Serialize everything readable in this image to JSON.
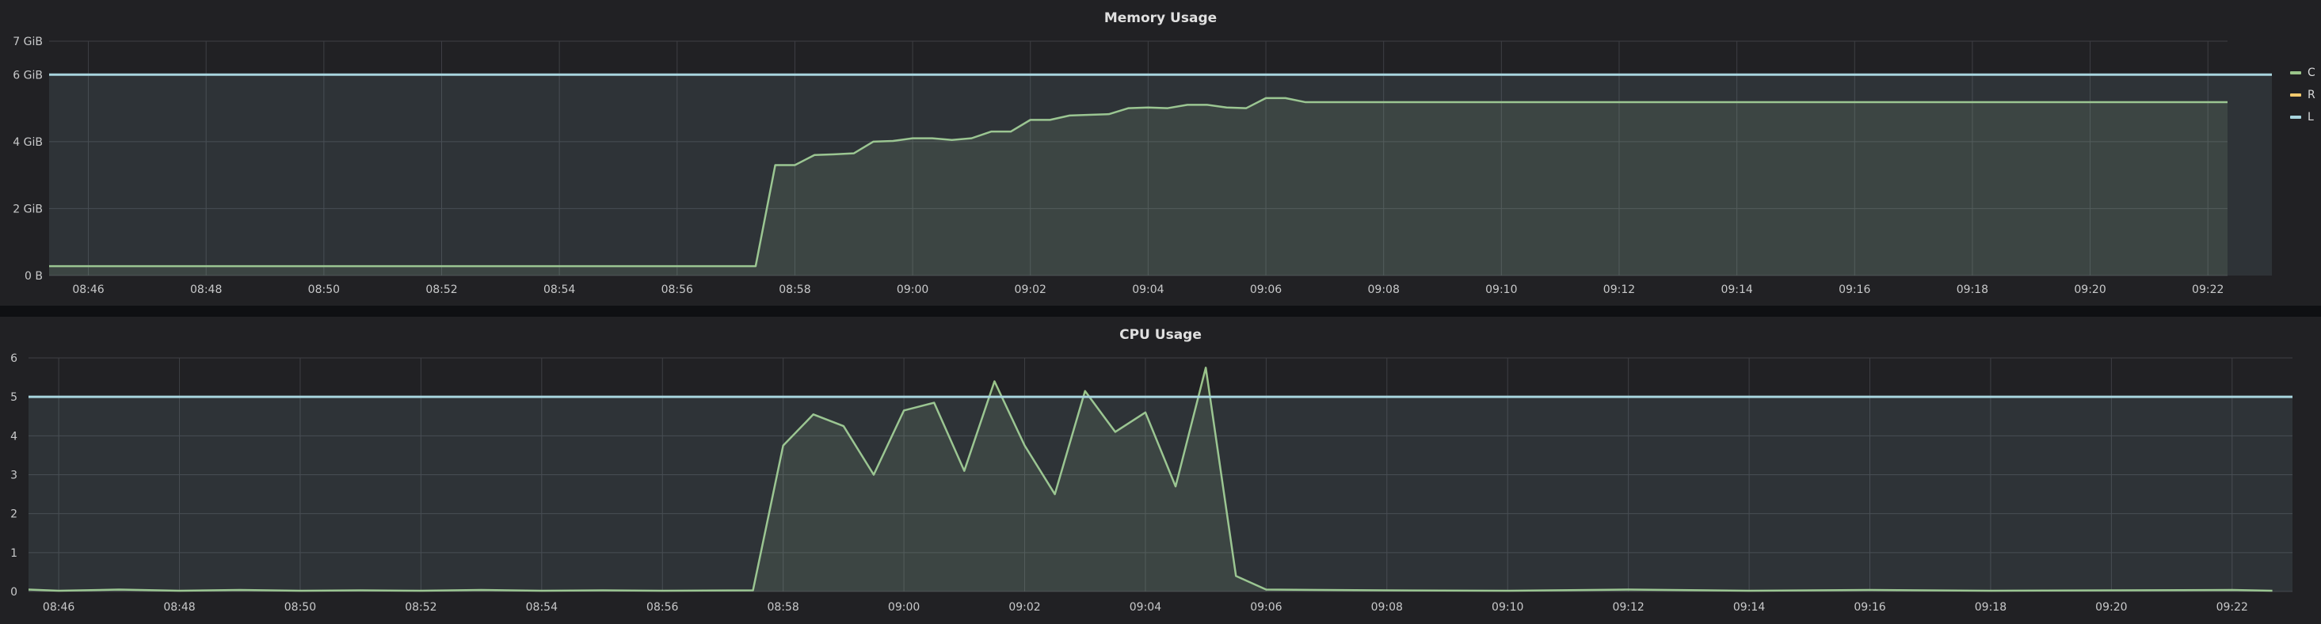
{
  "colors": {
    "series_current": "#9ac48a",
    "series_requests": "#f2c96d",
    "series_limits": "#a8d5de",
    "grid": "#3e3f44",
    "panel_bg": "#212124"
  },
  "legend": {
    "items": [
      {
        "label": "C",
        "color": "#9ac48a"
      },
      {
        "label": "R",
        "color": "#f2c96d"
      },
      {
        "label": "L",
        "color": "#a8d5de"
      }
    ]
  },
  "chart_data": [
    {
      "type": "area",
      "title": "Memory Usage",
      "unit": "GiB",
      "xlim": [
        "08:45:20",
        "09:22:20"
      ],
      "ylim": [
        0,
        7
      ],
      "x_ticks": [
        "08:46",
        "08:48",
        "08:50",
        "08:52",
        "08:54",
        "08:56",
        "08:58",
        "09:00",
        "09:02",
        "09:04",
        "09:06",
        "09:08",
        "09:10",
        "09:12",
        "09:14",
        "09:16",
        "09:18",
        "09:20",
        "09:22"
      ],
      "y_ticks": [
        "0 B",
        "2 GiB",
        "4 GiB",
        "6 GiB",
        "7 GiB"
      ],
      "y_tick_values": [
        0,
        2,
        4,
        6,
        7
      ],
      "grid": true,
      "legend_position": "right",
      "series": [
        {
          "name": "C",
          "color": "#9ac48a",
          "points": [
            [
              "08:45:20",
              0.28
            ],
            [
              "08:57:20",
              0.28
            ],
            [
              "08:57:40",
              3.3
            ],
            [
              "08:58:00",
              3.3
            ],
            [
              "08:58:20",
              3.6
            ],
            [
              "08:58:40",
              3.62
            ],
            [
              "08:59:00",
              3.65
            ],
            [
              "08:59:20",
              4.0
            ],
            [
              "08:59:40",
              4.02
            ],
            [
              "09:00:00",
              4.1
            ],
            [
              "09:00:20",
              4.1
            ],
            [
              "09:00:40",
              4.05
            ],
            [
              "09:01:00",
              4.1
            ],
            [
              "09:01:20",
              4.3
            ],
            [
              "09:01:40",
              4.3
            ],
            [
              "09:02:00",
              4.65
            ],
            [
              "09:02:20",
              4.65
            ],
            [
              "09:02:40",
              4.78
            ],
            [
              "09:03:00",
              4.8
            ],
            [
              "09:03:20",
              4.82
            ],
            [
              "09:03:40",
              5.0
            ],
            [
              "09:04:00",
              5.02
            ],
            [
              "09:04:20",
              5.0
            ],
            [
              "09:04:40",
              5.1
            ],
            [
              "09:05:00",
              5.1
            ],
            [
              "09:05:20",
              5.02
            ],
            [
              "09:05:40",
              5.0
            ],
            [
              "09:06:00",
              5.3
            ],
            [
              "09:06:20",
              5.3
            ],
            [
              "09:06:40",
              5.18
            ],
            [
              "09:22:20",
              5.18
            ]
          ]
        },
        {
          "name": "L",
          "color": "#a8d5de",
          "points": [
            [
              "08:45:20",
              6
            ],
            [
              "09:22:20",
              6
            ]
          ]
        }
      ]
    },
    {
      "type": "area",
      "title": "CPU Usage",
      "unit": "",
      "xlim": [
        "08:45:30",
        "09:23:00"
      ],
      "ylim": [
        0,
        6
      ],
      "x_ticks": [
        "08:46",
        "08:48",
        "08:50",
        "08:52",
        "08:54",
        "08:56",
        "08:58",
        "09:00",
        "09:02",
        "09:04",
        "09:06",
        "09:08",
        "09:10",
        "09:12",
        "09:14",
        "09:16",
        "09:18",
        "09:20",
        "09:22"
      ],
      "y_ticks": [
        "0",
        "1",
        "2",
        "3",
        "4",
        "5",
        "6"
      ],
      "y_tick_values": [
        0,
        1,
        2,
        3,
        4,
        5,
        6
      ],
      "grid": true,
      "legend_position": "right",
      "series": [
        {
          "name": "C",
          "color": "#9ac48a",
          "points": [
            [
              "08:45:30",
              0.05
            ],
            [
              "08:46:00",
              0.02
            ],
            [
              "08:47:00",
              0.05
            ],
            [
              "08:48:00",
              0.02
            ],
            [
              "08:49:00",
              0.04
            ],
            [
              "08:50:00",
              0.02
            ],
            [
              "08:51:00",
              0.03
            ],
            [
              "08:52:00",
              0.02
            ],
            [
              "08:53:00",
              0.04
            ],
            [
              "08:54:00",
              0.02
            ],
            [
              "08:55:00",
              0.03
            ],
            [
              "08:56:00",
              0.02
            ],
            [
              "08:57:30",
              0.03
            ],
            [
              "08:58:00",
              3.75
            ],
            [
              "08:58:30",
              4.55
            ],
            [
              "08:59:00",
              4.25
            ],
            [
              "08:59:30",
              3.0
            ],
            [
              "09:00:00",
              4.65
            ],
            [
              "09:00:30",
              4.85
            ],
            [
              "09:01:00",
              3.1
            ],
            [
              "09:01:30",
              5.4
            ],
            [
              "09:02:00",
              3.75
            ],
            [
              "09:02:30",
              2.5
            ],
            [
              "09:03:00",
              5.15
            ],
            [
              "09:03:30",
              4.1
            ],
            [
              "09:04:00",
              4.6
            ],
            [
              "09:04:30",
              2.7
            ],
            [
              "09:05:00",
              5.75
            ],
            [
              "09:05:30",
              0.4
            ],
            [
              "09:06:00",
              0.05
            ],
            [
              "09:08:00",
              0.03
            ],
            [
              "09:10:00",
              0.02
            ],
            [
              "09:12:00",
              0.05
            ],
            [
              "09:14:00",
              0.02
            ],
            [
              "09:16:00",
              0.04
            ],
            [
              "09:18:00",
              0.02
            ],
            [
              "09:20:00",
              0.03
            ],
            [
              "09:22:00",
              0.04
            ],
            [
              "09:22:40",
              0.02
            ]
          ]
        },
        {
          "name": "L",
          "color": "#a8d5de",
          "points": [
            [
              "08:45:30",
              5
            ],
            [
              "09:23:00",
              5
            ]
          ]
        }
      ]
    }
  ]
}
